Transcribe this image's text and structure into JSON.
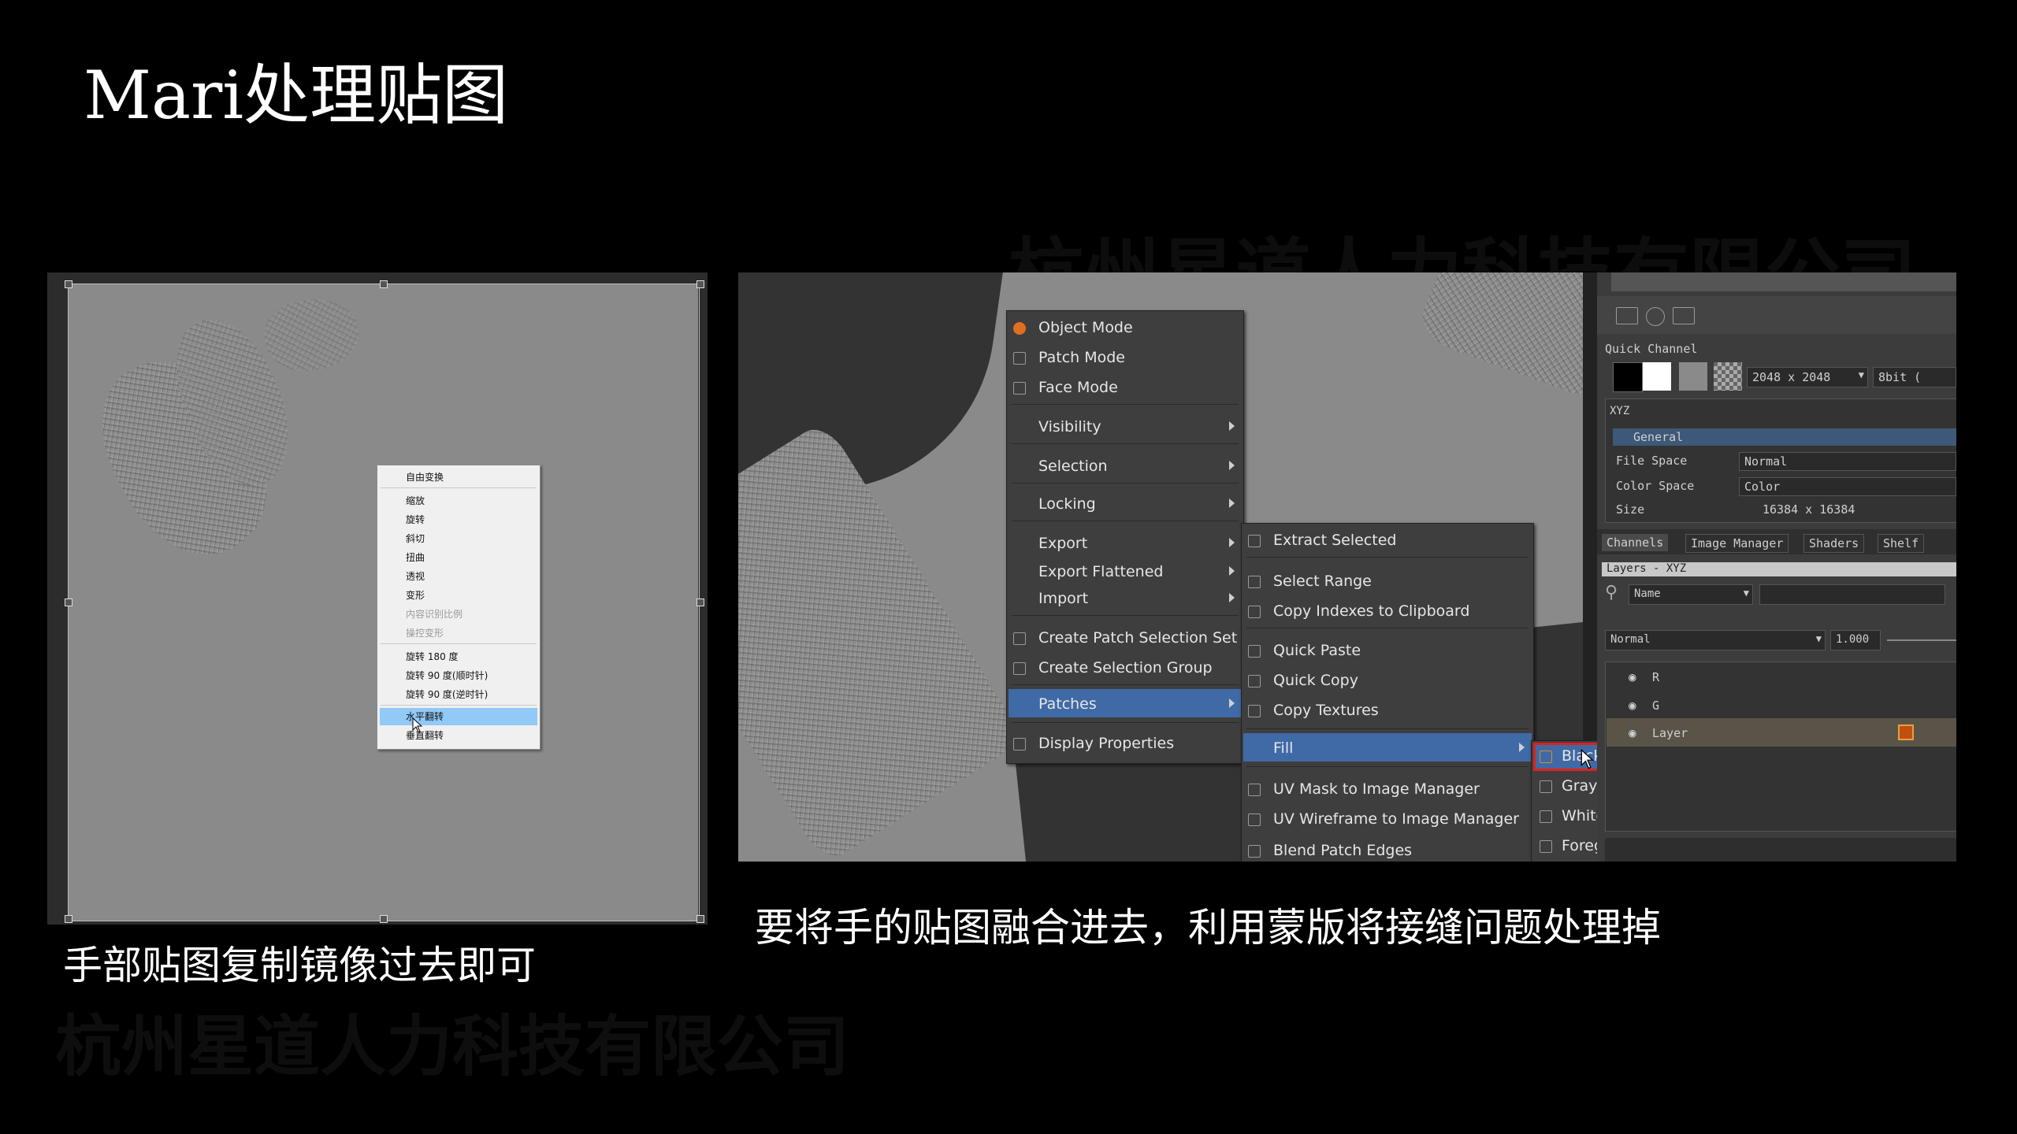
{
  "slide": {
    "title": "Mari处理贴图",
    "watermark_top": "杭州星道人力科技有限公司",
    "watermark_bottom": "杭州星道人力科技有限公司",
    "caption_left": "手部贴图复制镜像过去即可",
    "caption_right": "要将手的贴图融合进去，利用蒙版将接缝问题处理掉"
  },
  "photoshop_menu": {
    "items": [
      "自由变换",
      "缩放",
      "旋转",
      "斜切",
      "扭曲",
      "透视",
      "变形",
      "内容识别比例",
      "操控变形",
      "旋转 180 度",
      "旋转 90 度(顺时针)",
      "旋转 90 度(逆时针)",
      "水平翻转",
      "垂直翻转"
    ],
    "highlighted": "水平翻转"
  },
  "mari_menu": {
    "main": [
      "Object Mode",
      "Patch Mode",
      "Face Mode",
      "Visibility",
      "Selection",
      "Locking",
      "Export",
      "Export Flattened",
      "Import",
      "Create Patch Selection Set",
      "Create Selection Group",
      "Patches",
      "Display Properties"
    ],
    "patches_sub": [
      "Extract Selected",
      "Select Range",
      "Copy Indexes to Clipboard",
      "Quick Paste",
      "Quick Copy",
      "Copy Textures",
      "Fill",
      "UV Mask to Image Manager",
      "UV Wireframe to Image Manager",
      "Blend Patch Edges"
    ],
    "fill_sub": [
      "Black",
      "Gray",
      "White",
      "Foreground"
    ],
    "highlight_color": "#3f6aa6",
    "selection_box_color": "#e0201c"
  },
  "mari_panel": {
    "quick_channel_label": "Quick Channel",
    "resolution": "2048 x 2048",
    "depth": "8bit (",
    "group": "XYZ",
    "general_label": "General",
    "props": [
      {
        "label": "File Space",
        "value": "Normal"
      },
      {
        "label": "Color Space",
        "value": "Color"
      },
      {
        "label": "Size",
        "value": "16384 x 16384"
      }
    ],
    "tabs": [
      "Channels",
      "Image Manager",
      "Shaders",
      "Shelf"
    ],
    "layers_header": "Layers - XYZ",
    "filter_value": "Name",
    "blend_mode": "Normal",
    "opacity": "1.000",
    "layers": [
      "R",
      "G",
      "Layer"
    ]
  }
}
